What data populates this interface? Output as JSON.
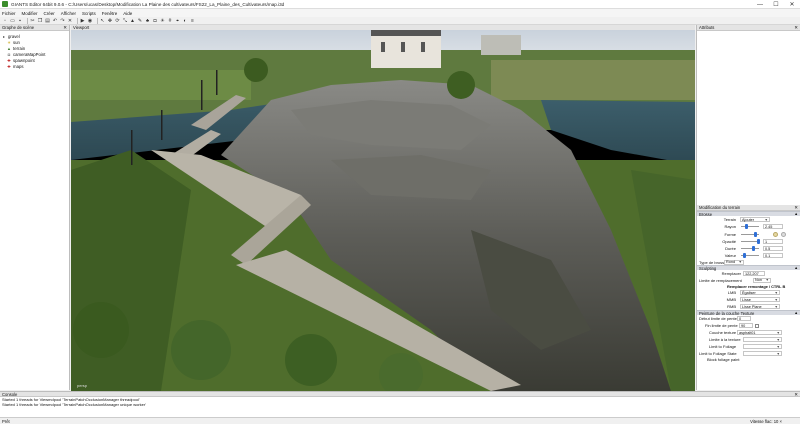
{
  "window": {
    "title": "GIANTS Editor 64bit 9.0.6 - C:/Users/ucas/Desktop/Modification La Plaine des cultivateurs/FS22_La_Plaine_des_Cultivateurs/map.i3d",
    "minimize": "—",
    "maximize": "☐",
    "close": "✕"
  },
  "menu": [
    "Fichier",
    "Modifier",
    "Créer",
    "Afficher",
    "Scripts",
    "Fenêtre",
    "Aide"
  ],
  "toolbar_icons": [
    "new-icon",
    "open-icon",
    "save-icon",
    "cut-icon",
    "copy-icon",
    "paste-icon",
    "undo-icon",
    "redo-icon",
    "delete-icon",
    "play-icon",
    "eye-icon",
    "select-icon",
    "move-icon",
    "rotate-icon",
    "scale-icon",
    "terrain-icon",
    "paint-icon",
    "foliage-icon",
    "camera-icon",
    "light-icon",
    "grid-icon",
    "snap-icon",
    "shader-icon",
    "script-icon"
  ],
  "scenegraph": {
    "header": "Graphe de scène",
    "items": [
      {
        "label": "gravel",
        "indent": 0
      },
      {
        "label": "sun",
        "indent": 1
      },
      {
        "label": "terrain",
        "indent": 1
      },
      {
        "label": "cameraMapPoint",
        "indent": 1
      },
      {
        "label": "spawnpoint",
        "indent": 1
      },
      {
        "label": "maps",
        "indent": 1
      }
    ]
  },
  "viewport": {
    "header": "Viewport",
    "camera_label": "persp"
  },
  "attributes": {
    "header": "Attributs"
  },
  "terrain_edit": {
    "header": "Modification du terrain",
    "brush_section": "Brosse",
    "fields": {
      "mode_label": "Terrain",
      "mode_value": "Ajouter",
      "radius_label": "Rayon",
      "radius_value": "2.45",
      "shape_label": "Forme",
      "opacity_label": "Opacité",
      "opacity_value": "1",
      "duration_label": "Durée",
      "duration_value": "0.5",
      "value_label": "Valeur",
      "value_value": "0.1",
      "brush_type_label": "Type de brosse",
      "brush_type_value": "Rond"
    },
    "sculpting_section": "Sculpting",
    "sculpt_fields": {
      "replace_label": "Remplacer",
      "replace_value": "122,207",
      "limit_label": "Limite de remplacement",
      "limit_value": "Non",
      "hint": "Remplacer remontage / CTRL B",
      "lmb_label": "LMB",
      "lmb_value": "Égaliser",
      "mmb_label": "MMB",
      "mmb_value": "Lisse",
      "rmb_label": "RMB",
      "rmb_value": "Lisse Plane"
    },
    "paint_section": "Peinture de la couche Texture",
    "paint_fields": {
      "start_label": "Début limite de pente",
      "start_value": "0",
      "end_label": "Fin limite de pente",
      "end_value": "90",
      "layer_label": "Couche texture",
      "layer_value": "asphalt01",
      "tex_limit_label": "Limite à la texture",
      "foliage_limit_label": "Limit to Foliage",
      "foliage_state_label": "Limit to Foliage State",
      "block_label": "Block foliage paint"
    }
  },
  "console": {
    "header": "Console",
    "lines": [
      "Started 1 threads for Viewmdpool 'TerrainPatchOcclusionManager threadpool'",
      "Started 1 threads for Viewmdpool 'TerrainPatchOcclusionManager unique worker'"
    ]
  },
  "statusbar": {
    "left": "Prêt",
    "right": "Vitesse flac: 10 ×"
  },
  "colors": {
    "accent": "#2f6fd6",
    "panel_header": "#d8dbe2"
  }
}
